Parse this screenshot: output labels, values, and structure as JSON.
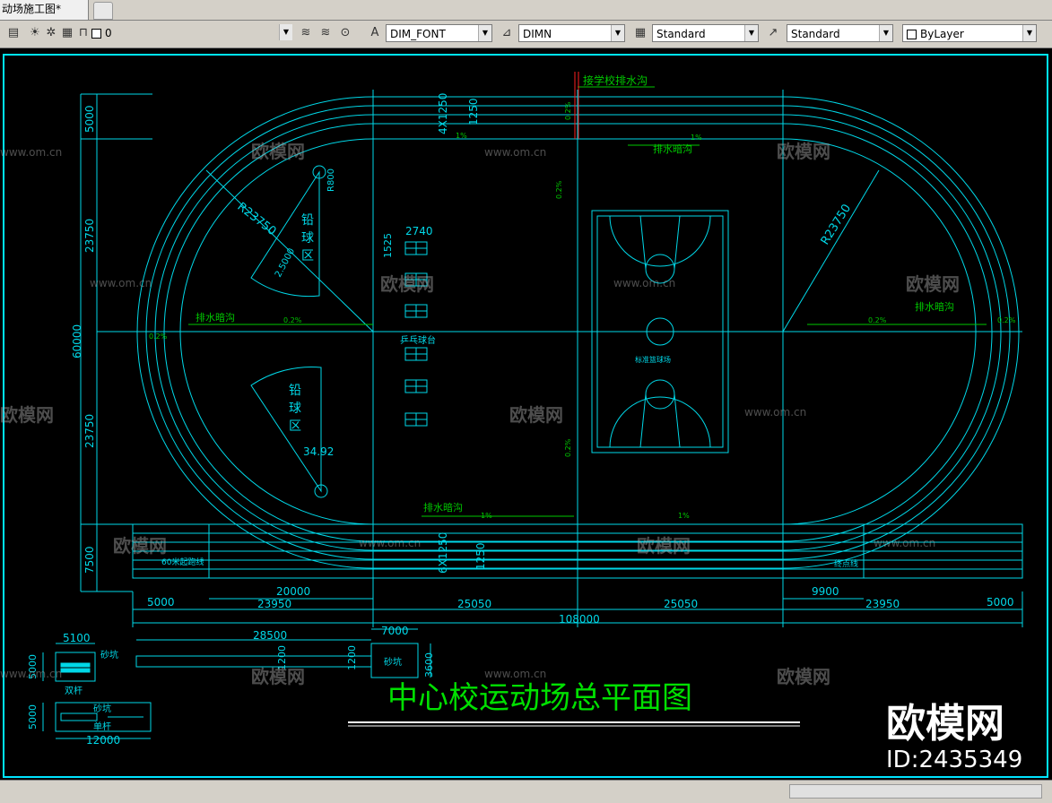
{
  "window": {
    "tab_title": "动场施工图*"
  },
  "toolbar": {
    "layer_name": "0",
    "text_style": "DIM_FONT",
    "dim_style": "DIMN",
    "table_style": "Standard",
    "multileader_style": "Standard",
    "color": "ByLayer"
  },
  "drawing": {
    "title": "中心校运动场总平面图",
    "notes": {
      "school_drain": "接学校排水沟",
      "drain_top": "排水暗沟",
      "drain_left": "排水暗沟",
      "drain_right": "排水暗沟",
      "drain_bottom": "排水暗沟",
      "pingpong": "乒乓球台",
      "shotput_top": "铅球区",
      "shotput_top_c1": "铅",
      "shotput_top_c2": "球",
      "shotput_top_c3": "区",
      "shotput_bot_c1": "铅",
      "shotput_bot_c2": "球",
      "shotput_bot_c3": "区",
      "basketball": "标准篮球场",
      "start_line": "60米起跑线",
      "finish_line": "终点线",
      "long_jump_pit_1": "砂坑",
      "long_jump_pit_2": "砂坑",
      "long_jump_pit_3": "砂坑",
      "parallel_bars": "双杆",
      "single_bar": "单杆"
    },
    "dims": {
      "total_width": "108000",
      "w5000_left": "5000",
      "w23950_left": "23950",
      "w25050_left": "25050",
      "w25050_right": "25050",
      "w23950_right": "23950",
      "w5000_right": "5000",
      "w20000": "20000",
      "w9900": "9900",
      "h5000": "5000",
      "h23750_top": "23750",
      "h60000": "60000",
      "h23750_bot": "23750",
      "h7500": "7500",
      "r_left": "R23750",
      "r_right": "R23750",
      "r_small": "R800",
      "lanes_top": "4X1250",
      "lane_top": "1250",
      "lanes_bot": "6X1250",
      "lane_bot": "1250",
      "table_w": "2740",
      "table_h": "1525",
      "sector_r": "34.92",
      "sector_r2": "2.5000",
      "slope_1": "0.2%",
      "slope_2": "1%",
      "slope_3": "0.2%",
      "slope_4": "0.2%",
      "slope_5": "0.2%",
      "slope_6": "1%",
      "slope_7": "1%",
      "slope_8": "0.2%",
      "slope_9": "0.2%",
      "slope_10": "0.2%",
      "slope_11": "1%",
      "runway_len": "28500",
      "pit_w": "7000",
      "pit_h": "3600",
      "runway_w1": "1200",
      "runway_w2": "1200",
      "pb_w": "5100",
      "pb_h": "5000",
      "sb_w": "12000",
      "sb_h": "5000"
    }
  },
  "watermark": {
    "brand": "欧模网",
    "url": "www.om.cn",
    "id": "ID:2435349"
  }
}
